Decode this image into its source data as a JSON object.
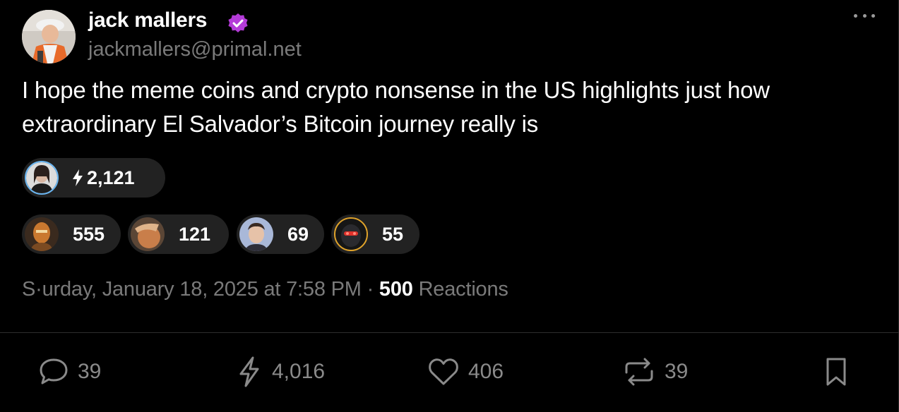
{
  "author": {
    "name": "jack mallers",
    "handle": "jackmallers@primal.net",
    "verified_color": "#b43bd8"
  },
  "post": {
    "text": "I hope the meme coins and crypto nonsense in the US highlights just how extraordinary El Salvador’s Bitcoin journey really is"
  },
  "zaps": {
    "top": {
      "amount": "2,121",
      "icon": "lightning-bolt-icon"
    },
    "others": [
      {
        "amount": "555"
      },
      {
        "amount": "121"
      },
      {
        "amount": "69"
      },
      {
        "amount": "55"
      }
    ]
  },
  "meta": {
    "date": "S·urday, January 18, 2025 at 7:58 PM",
    "separator": "·",
    "reactions_count": "500",
    "reactions_label": "Reactions"
  },
  "actions": {
    "replies": "39",
    "zaps": "4,016",
    "likes": "406",
    "reposts": "39"
  }
}
